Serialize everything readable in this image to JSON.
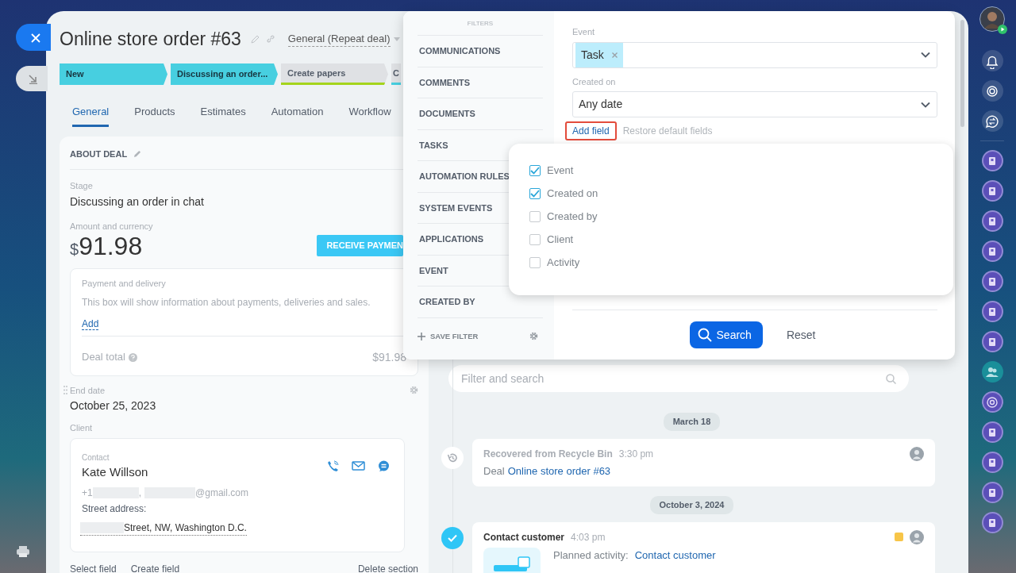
{
  "deal": {
    "title": "Online store order #63",
    "pipeline": "General (Repeat deal)"
  },
  "stages": [
    {
      "label": "New",
      "reached": true,
      "color": "#47cfe0"
    },
    {
      "label": "Discussing an order...",
      "reached": true,
      "color": "#47cfe0"
    },
    {
      "label": "Create papers",
      "reached": false,
      "color": "#a4d41c"
    },
    {
      "label": "C",
      "reached": false,
      "color": "#47cfe0"
    }
  ],
  "tabs": [
    {
      "label": "General",
      "selected": true
    },
    {
      "label": "Products",
      "selected": false
    },
    {
      "label": "Estimates",
      "selected": false
    },
    {
      "label": "Automation",
      "selected": false
    },
    {
      "label": "Workflow",
      "selected": false
    }
  ],
  "about": {
    "heading": "ABOUT DEAL",
    "stage_label": "Stage",
    "stage_value": "Discussing an order in chat",
    "amount_label": "Amount and currency",
    "currency": "$",
    "amount": "91.98",
    "pay_button": "RECEIVE PAYMEN"
  },
  "payment_box": {
    "title": "Payment and delivery",
    "text": "This box will show information about payments, deliveries and sales.",
    "add_link": "Add",
    "total_label": "Deal total",
    "total_value": "$91.98"
  },
  "end_date": {
    "label": "End date",
    "value": "October 25, 2023"
  },
  "client": {
    "label": "Client",
    "contact_label": "Contact",
    "name": "Kate Willson",
    "phone": "+1",
    "separator": ",",
    "email": "@gmail.com",
    "address_label": "Street address:",
    "address": "Street, NW, Washington D.C."
  },
  "card_links": [
    "Select field",
    "Create field"
  ],
  "delete_link": "Delete section",
  "filter": {
    "heading": "FILTERS",
    "presets": [
      "COMMUNICATIONS",
      "COMMENTS",
      "DOCUMENTS",
      "TASKS",
      "AUTOMATION RULES",
      "SYSTEM EVENTS",
      "APPLICATIONS",
      "EVENT",
      "CREATED BY"
    ],
    "save": "SAVE FILTER",
    "fields": [
      {
        "label": "Event",
        "kind": "tags",
        "tags": [
          "Task"
        ]
      },
      {
        "label": "Created on",
        "kind": "select",
        "value": "Any date"
      }
    ],
    "add_field": "Add field",
    "restore": "Restore default fields",
    "search_button": "Search",
    "reset_button": "Reset"
  },
  "field_menu": [
    {
      "label": "Event",
      "checked": true
    },
    {
      "label": "Created on",
      "checked": true
    },
    {
      "label": "Created by",
      "checked": false
    },
    {
      "label": "Client",
      "checked": false
    },
    {
      "label": "Activity",
      "checked": false
    }
  ],
  "timeline": {
    "search_placeholder": "Filter and search",
    "groups": [
      {
        "date": "March 18",
        "items": [
          {
            "kind": "restored",
            "title": "Recovered from Recycle Bin",
            "time": "3:30 pm",
            "prefix": "Deal",
            "link": "Online store order #63"
          }
        ]
      },
      {
        "date": "October 3, 2024",
        "items": [
          {
            "kind": "activity",
            "title": "Contact customer",
            "time": "4:03 pm",
            "color": "#f7c548",
            "field_label": "Planned activity:",
            "link": "Contact customer"
          }
        ]
      }
    ]
  },
  "rail": {
    "items": [
      {
        "kind": "bell"
      },
      {
        "kind": "spiral"
      },
      {
        "kind": "exchange"
      },
      {
        "kind": "divider"
      },
      {
        "kind": "book"
      },
      {
        "kind": "book"
      },
      {
        "kind": "book"
      },
      {
        "kind": "book"
      },
      {
        "kind": "book"
      },
      {
        "kind": "book"
      },
      {
        "kind": "book"
      },
      {
        "kind": "people"
      },
      {
        "kind": "spiral-app"
      },
      {
        "kind": "book"
      },
      {
        "kind": "book"
      },
      {
        "kind": "book"
      },
      {
        "kind": "book"
      }
    ]
  }
}
